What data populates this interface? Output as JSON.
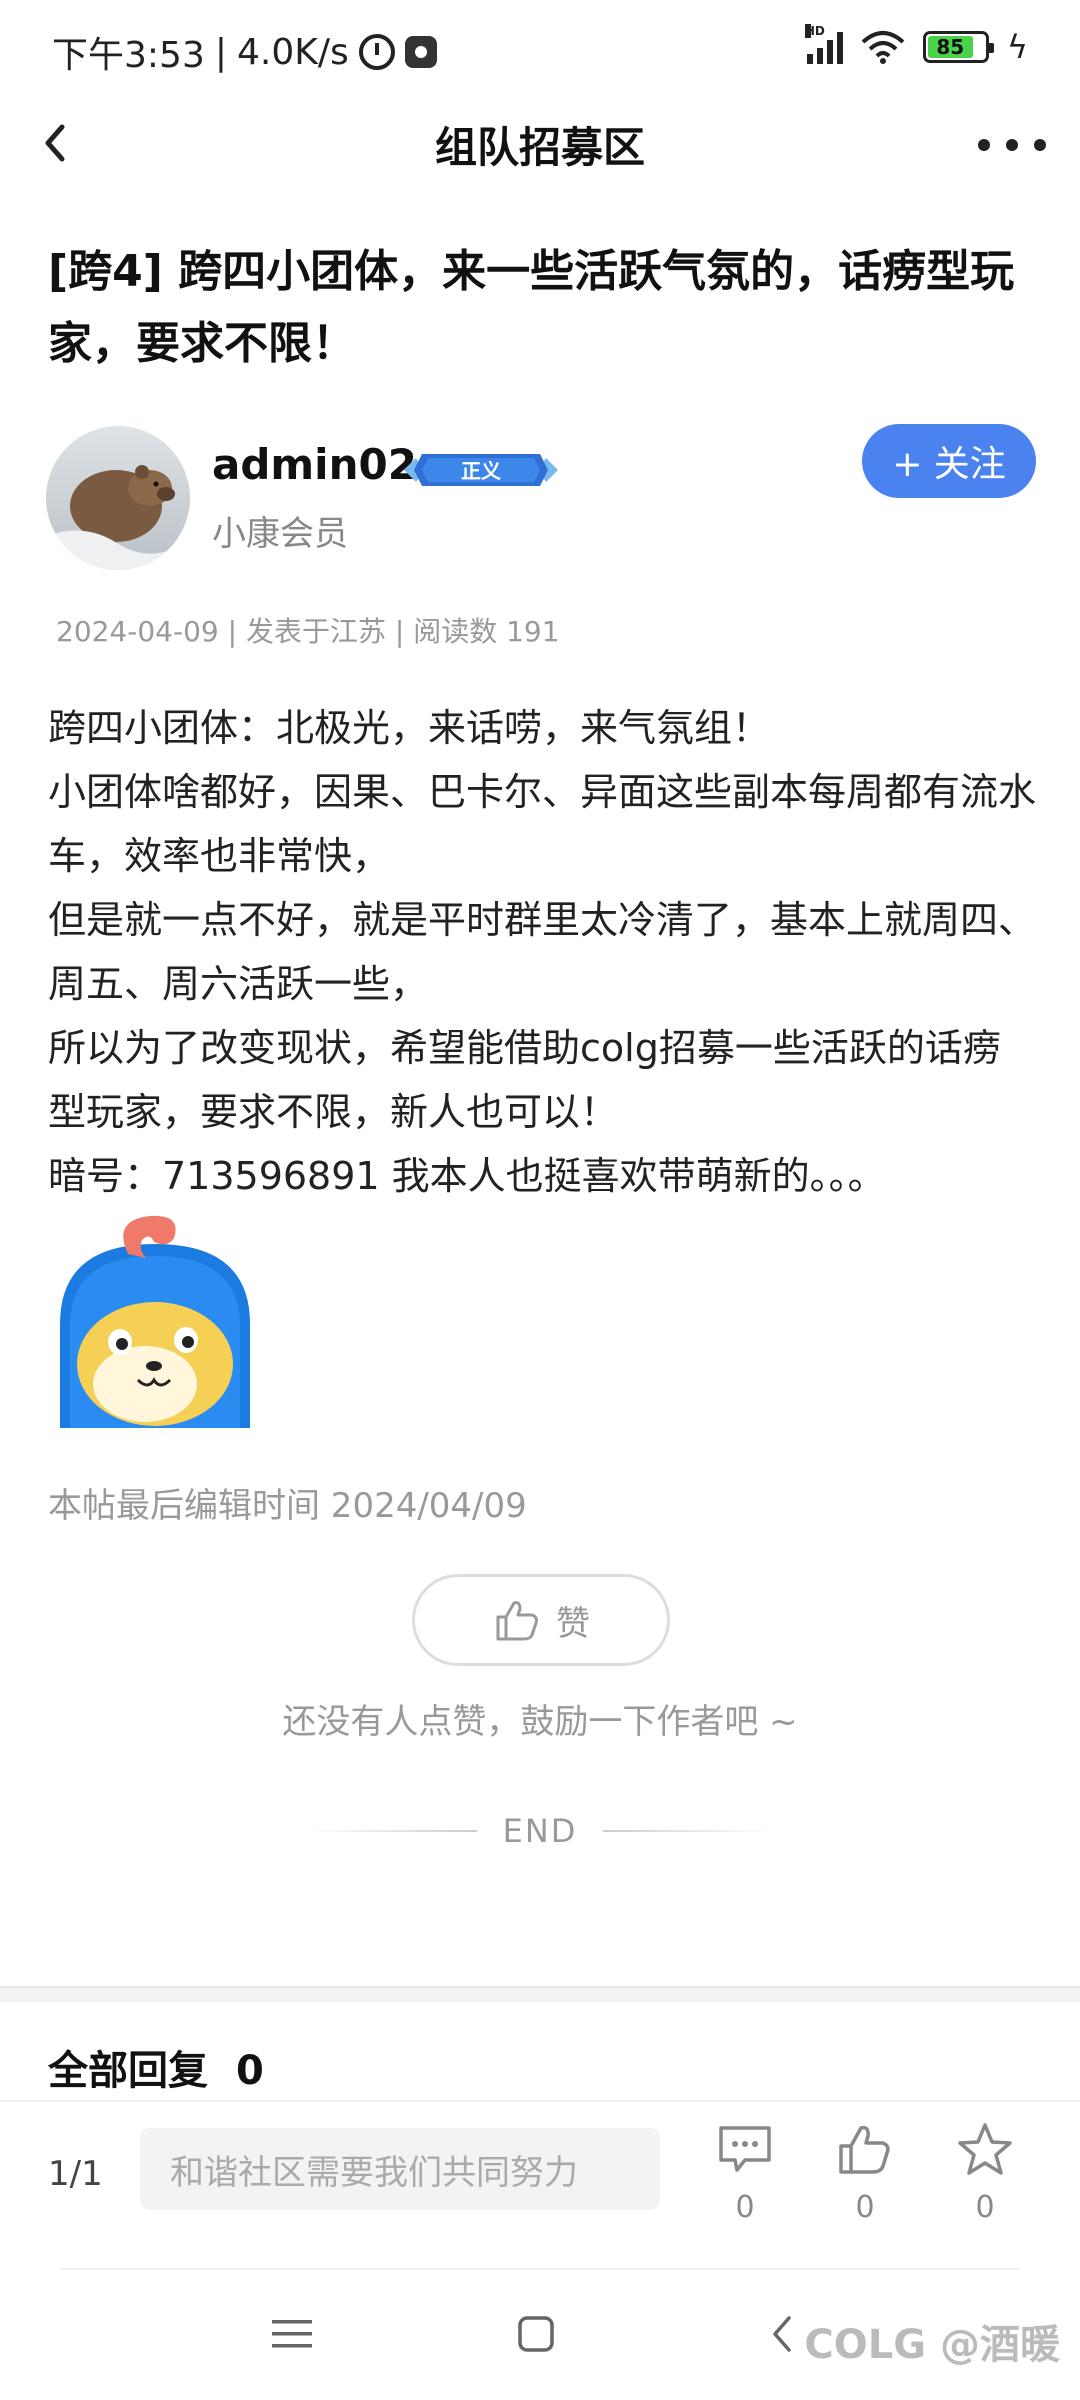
{
  "status_bar": {
    "time": "下午3:53",
    "net_speed": "4.0K/s",
    "signal_label": "HD",
    "battery": "85"
  },
  "header": {
    "title": "组队招募区"
  },
  "post": {
    "title": "[跨4] 跨四小团体，来一些活跃气氛的，话痨型玩家，要求不限！",
    "author": {
      "name": "admin02",
      "level": "小康会员",
      "badge_text": "正义"
    },
    "follow_label": "+ 关注",
    "meta": "2024-04-09 | 发表于江苏 | 阅读数 191",
    "body": [
      "跨四小团体：北极光，来话唠，来气氛组！",
      "小团体啥都好，因果、巴卡尔、异面这些副本每周都有流水车，效率也非常快，",
      "但是就一点不好，就是平时群里太冷清了，基本上就周四、周五、周六活跃一些，",
      "所以为了改变现状，希望能借助colg招募一些活跃的话痨型玩家，要求不限，新人也可以！",
      "暗号：713596891 我本人也挺喜欢带萌新的。。。"
    ],
    "edit_time": "本帖最后编辑时间 2024/04/09",
    "like_label": "赞",
    "like_hint": "还没有人点赞，鼓励一下作者吧 ~",
    "end_label": "END"
  },
  "replies": {
    "title": "全部回复",
    "count": "0"
  },
  "action_bar": {
    "page": "1/1",
    "input_placeholder": "和谐社区需要我们共同努力",
    "comment_count": "0",
    "like_count": "0",
    "fav_count": "0"
  },
  "watermark": "COLG @酒暖",
  "colors": {
    "accent": "#4a82f0",
    "battery": "#4bd24b"
  },
  "icons": [
    "back-icon",
    "more-icon",
    "thumb-up-icon",
    "comment-icon",
    "star-icon",
    "menu-icon",
    "home-icon",
    "nav-back-icon"
  ]
}
